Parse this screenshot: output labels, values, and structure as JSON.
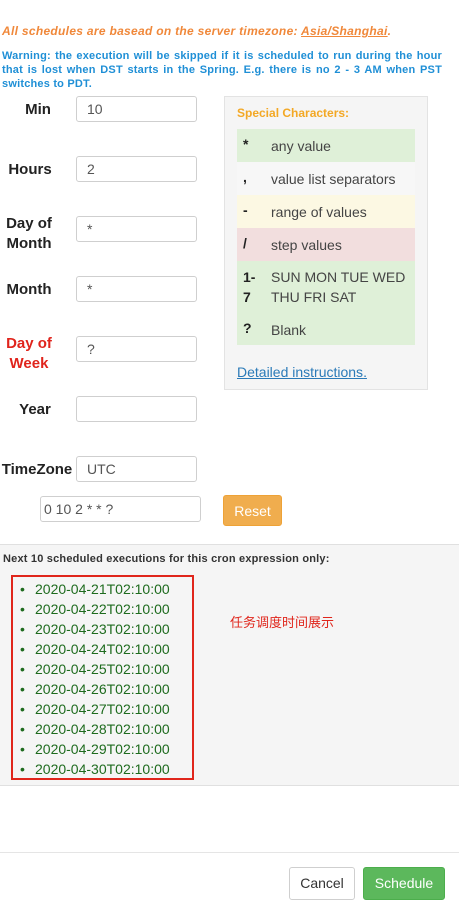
{
  "notice": {
    "prefix": "All schedules are basead on the server timezone: ",
    "timezone": "Asia/Shanghai",
    "suffix": "."
  },
  "warning": "Warning: the execution will be skipped if it is scheduled to run during the hour that is lost when DST starts in the Spring. E.g. there is no 2 - 3 AM when PST switches to PDT.",
  "fields": {
    "min": {
      "label": "Min",
      "value": "10"
    },
    "hours": {
      "label": "Hours",
      "value": "2"
    },
    "day_of_month": {
      "label": "Day of Month",
      "value": "*"
    },
    "month": {
      "label": "Month",
      "value": "*"
    },
    "day_of_week": {
      "label": "Day of Week",
      "value": "?"
    },
    "year": {
      "label": "Year",
      "value": ""
    },
    "timezone": {
      "label": "TimeZone",
      "value": "UTC"
    }
  },
  "expression": "0 10 2 * * ?",
  "reset_label": "Reset",
  "legend": {
    "title": "Special Characters:",
    "rows": [
      {
        "symbol": "*",
        "text": "any value"
      },
      {
        "symbol": ",",
        "text": "value list separators"
      },
      {
        "symbol": "-",
        "text": "range of values"
      },
      {
        "symbol": "/",
        "text": "step values"
      },
      {
        "symbol": "1-7",
        "text": "SUN MON TUE WED THU FRI SAT"
      },
      {
        "symbol": "?",
        "text": "Blank"
      }
    ],
    "link": "Detailed instructions",
    "link_suffix": "."
  },
  "next": {
    "title": "Next 10 scheduled executions for this cron expression only:",
    "executions": [
      "2020-04-21T02:10:00",
      "2020-04-22T02:10:00",
      "2020-04-23T02:10:00",
      "2020-04-24T02:10:00",
      "2020-04-25T02:10:00",
      "2020-04-26T02:10:00",
      "2020-04-27T02:10:00",
      "2020-04-28T02:10:00",
      "2020-04-29T02:10:00",
      "2020-04-30T02:10:00"
    ],
    "annotation": "任务调度时间展示"
  },
  "footer": {
    "cancel": "Cancel",
    "schedule": "Schedule"
  },
  "colors": {
    "notice": "#f0883a",
    "warning": "#1f8fd6",
    "legend_title": "#f3a825",
    "day_of_week_label": "#e0241c",
    "execution_text": "#1e6b1e",
    "highlight_box": "#e0261c",
    "reset": "#f0ad4e",
    "schedule": "#5cb85c"
  }
}
